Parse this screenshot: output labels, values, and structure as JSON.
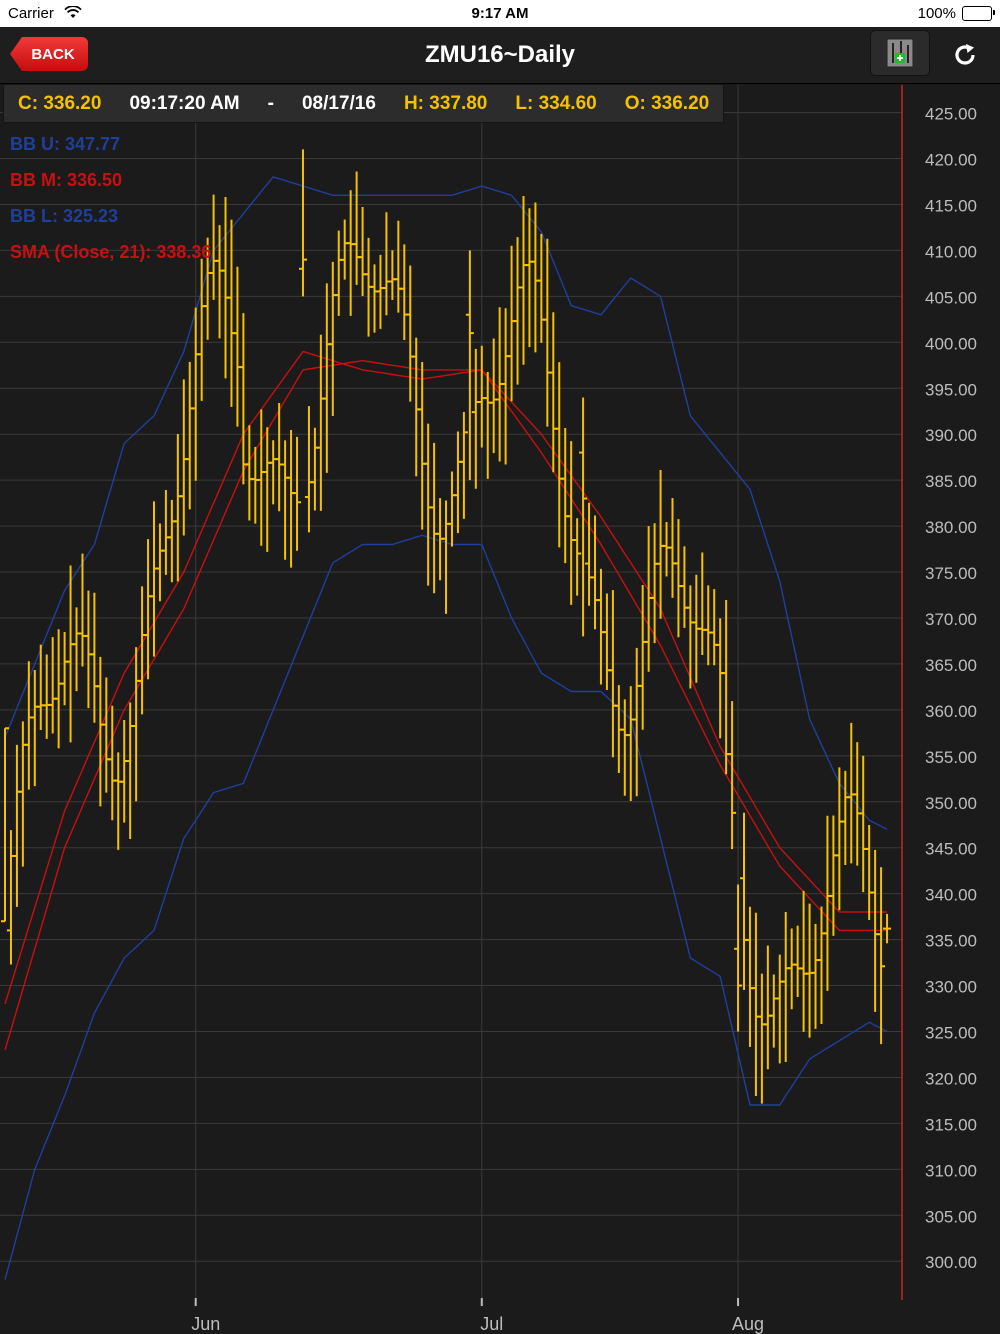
{
  "status_bar": {
    "carrier": "Carrier",
    "time": "9:17 AM",
    "battery": "100%"
  },
  "nav": {
    "back_label": "BACK",
    "title": "ZMU16~Daily"
  },
  "quote": {
    "close": "C: 336.20",
    "time": "09:17:20 AM",
    "separator": "-",
    "date": "08/17/16",
    "high": "H: 337.80",
    "low": "L: 334.60",
    "open": "O: 336.20"
  },
  "legend": {
    "bb_upper": "BB U: 347.77",
    "bb_middle": "BB M: 336.50",
    "bb_lower": "BB L: 325.23",
    "sma": "SMA (Close, 21): 338.36"
  },
  "colors": {
    "bar": "#f5c100",
    "bb_band": "#1f3f9e",
    "bb_mid": "#c81010",
    "sma": "#c81010",
    "grid": "#3a3a3a",
    "axis_text": "#bdbdbd"
  },
  "chart_data": {
    "type": "ohlc",
    "y_axis": {
      "ylim": [
        296,
        428
      ],
      "ticks": [
        300,
        305,
        310,
        315,
        320,
        325,
        330,
        335,
        340,
        345,
        350,
        355,
        360,
        365,
        370,
        375,
        380,
        385,
        390,
        395,
        400,
        405,
        410,
        415,
        420,
        425
      ],
      "tick_labels": [
        "300.00",
        "305.00",
        "310.00",
        "315.00",
        "320.00",
        "325.00",
        "330.00",
        "335.00",
        "340.00",
        "345.00",
        "350.00",
        "355.00",
        "360.00",
        "365.00",
        "370.00",
        "375.00",
        "380.00",
        "385.00",
        "390.00",
        "395.00",
        "400.00",
        "405.00",
        "410.00",
        "415.00",
        "420.00",
        "425.00"
      ]
    },
    "x_axis": {
      "labels": [
        {
          "text": "Jun",
          "index": 32
        },
        {
          "text": "Jul",
          "index": 80
        },
        {
          "text": "Aug",
          "index": 123
        }
      ],
      "count": 150
    },
    "series": [
      {
        "name": "SMA (Close, 21)",
        "x": [
          0,
          10,
          20,
          30,
          40,
          50,
          60,
          70,
          80,
          90,
          100,
          110,
          120,
          130,
          140,
          148
        ],
        "values": [
          323,
          345,
          360,
          371,
          386,
          397,
          398,
          397,
          397,
          390,
          381,
          371,
          356,
          345,
          338,
          338
        ]
      },
      {
        "name": "BB M",
        "x": [
          0,
          10,
          20,
          30,
          40,
          50,
          60,
          70,
          80,
          90,
          100,
          110,
          120,
          130,
          140,
          148
        ],
        "values": [
          328,
          349,
          364,
          375,
          390,
          399,
          397,
          396,
          397,
          388,
          378,
          367,
          354,
          343,
          336,
          336
        ]
      },
      {
        "name": "BB U",
        "x": [
          0,
          5,
          10,
          15,
          20,
          25,
          30,
          35,
          40,
          45,
          50,
          55,
          60,
          65,
          70,
          75,
          80,
          85,
          90,
          95,
          100,
          105,
          110,
          115,
          120,
          125,
          130,
          135,
          140,
          145,
          148
        ],
        "values": [
          357,
          365,
          373,
          378,
          389,
          392,
          399,
          410,
          414,
          418,
          417,
          416,
          416,
          416,
          416,
          416,
          417,
          416,
          412,
          404,
          403,
          407,
          405,
          392,
          388,
          384,
          374,
          359,
          352,
          348,
          347
        ]
      },
      {
        "name": "BB L",
        "x": [
          0,
          5,
          10,
          15,
          20,
          25,
          30,
          35,
          40,
          45,
          50,
          55,
          60,
          65,
          70,
          75,
          80,
          85,
          90,
          95,
          100,
          105,
          110,
          115,
          120,
          125,
          130,
          135,
          140,
          145,
          148
        ],
        "values": [
          298,
          310,
          318,
          327,
          333,
          336,
          346,
          351,
          352,
          360,
          368,
          376,
          378,
          378,
          379,
          378,
          378,
          370,
          364,
          362,
          362,
          359,
          346,
          333,
          331,
          317,
          317,
          322,
          324,
          326,
          325
        ]
      }
    ],
    "ohlc_sample": [
      {
        "x": 0,
        "o": 337,
        "h": 358,
        "l": 337,
        "c": 358
      },
      {
        "x": 50,
        "o": 408,
        "h": 421,
        "l": 405,
        "c": 409
      },
      {
        "x": 78,
        "o": 403,
        "h": 410,
        "l": 385,
        "c": 401
      },
      {
        "x": 97,
        "o": 388,
        "h": 394,
        "l": 368,
        "c": 383
      },
      {
        "x": 123,
        "o": 334,
        "h": 341,
        "l": 325,
        "c": 330
      },
      {
        "x": 148,
        "o": 336.2,
        "h": 337.8,
        "l": 334.6,
        "c": 336.2
      }
    ]
  }
}
